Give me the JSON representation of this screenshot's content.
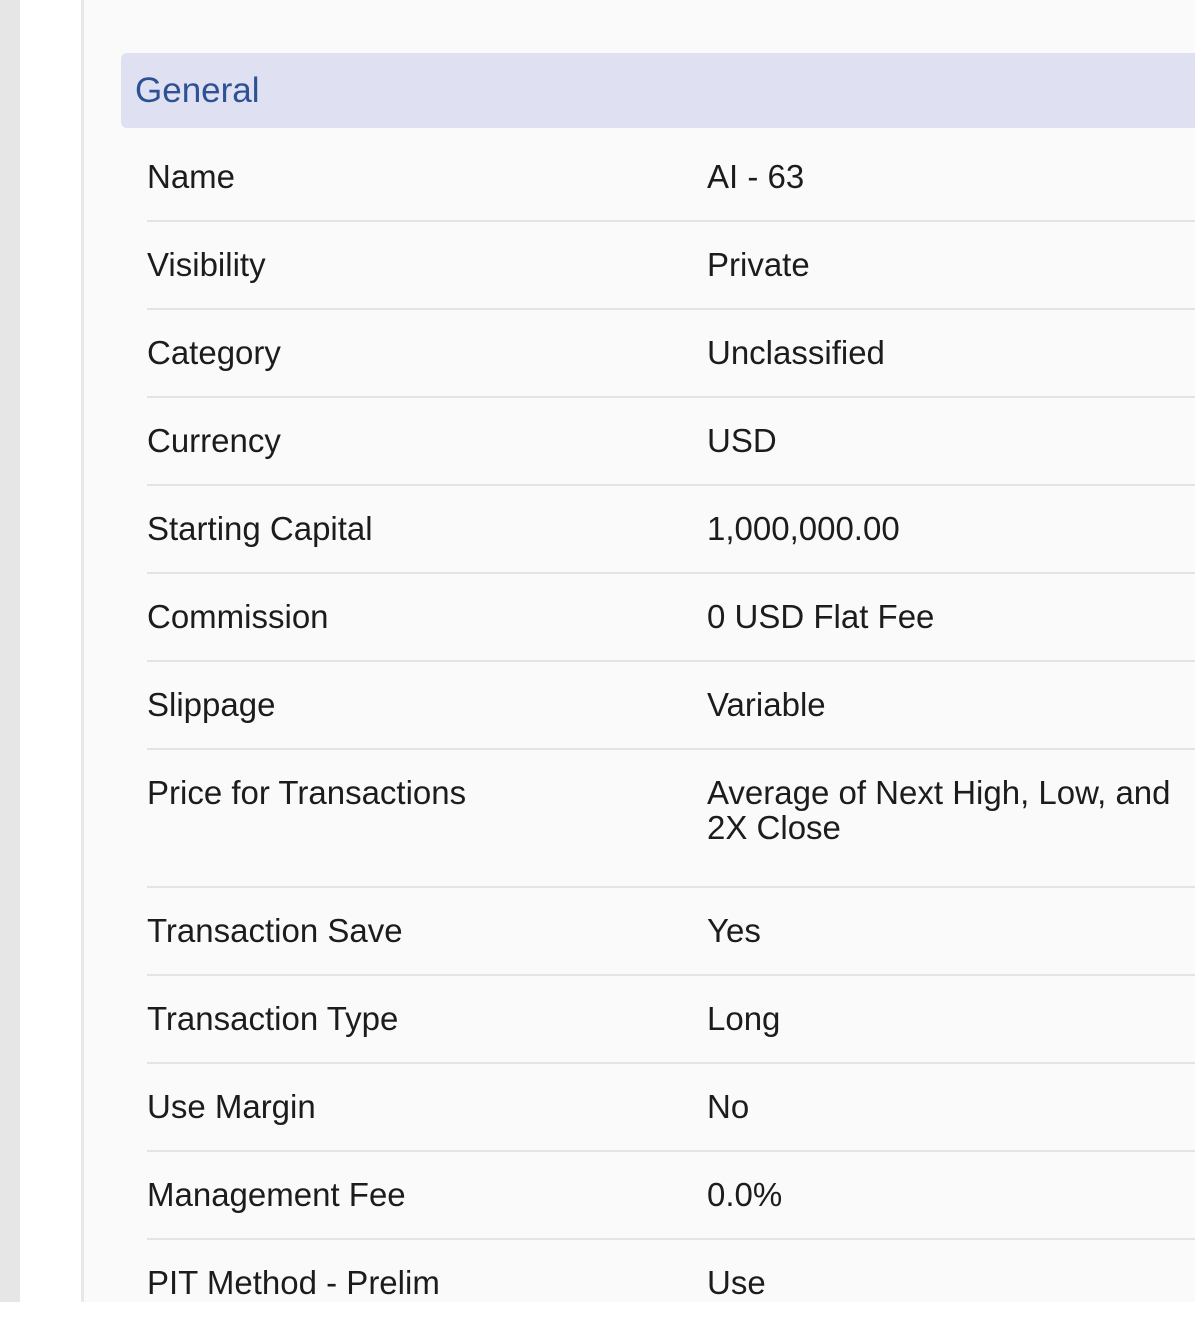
{
  "section": {
    "title": "General"
  },
  "rows": [
    {
      "label": "Name",
      "value": "AI - 63"
    },
    {
      "label": "Visibility",
      "value": "Private"
    },
    {
      "label": "Category",
      "value": "Unclassified"
    },
    {
      "label": "Currency",
      "value": "USD"
    },
    {
      "label": "Starting Capital",
      "value": "1,000,000.00"
    },
    {
      "label": "Commission",
      "value": "0 USD Flat Fee"
    },
    {
      "label": "Slippage",
      "value": "Variable"
    },
    {
      "label": "Price for Transactions",
      "value": "Average of Next High, Low, and 2X Close"
    },
    {
      "label": "Transaction Save",
      "value": "Yes"
    },
    {
      "label": "Transaction Type",
      "value": "Long"
    },
    {
      "label": "Use Margin",
      "value": "No"
    },
    {
      "label": "Management Fee",
      "value": "0.0%"
    },
    {
      "label": "PIT Method - Prelim",
      "value": "Use"
    }
  ]
}
